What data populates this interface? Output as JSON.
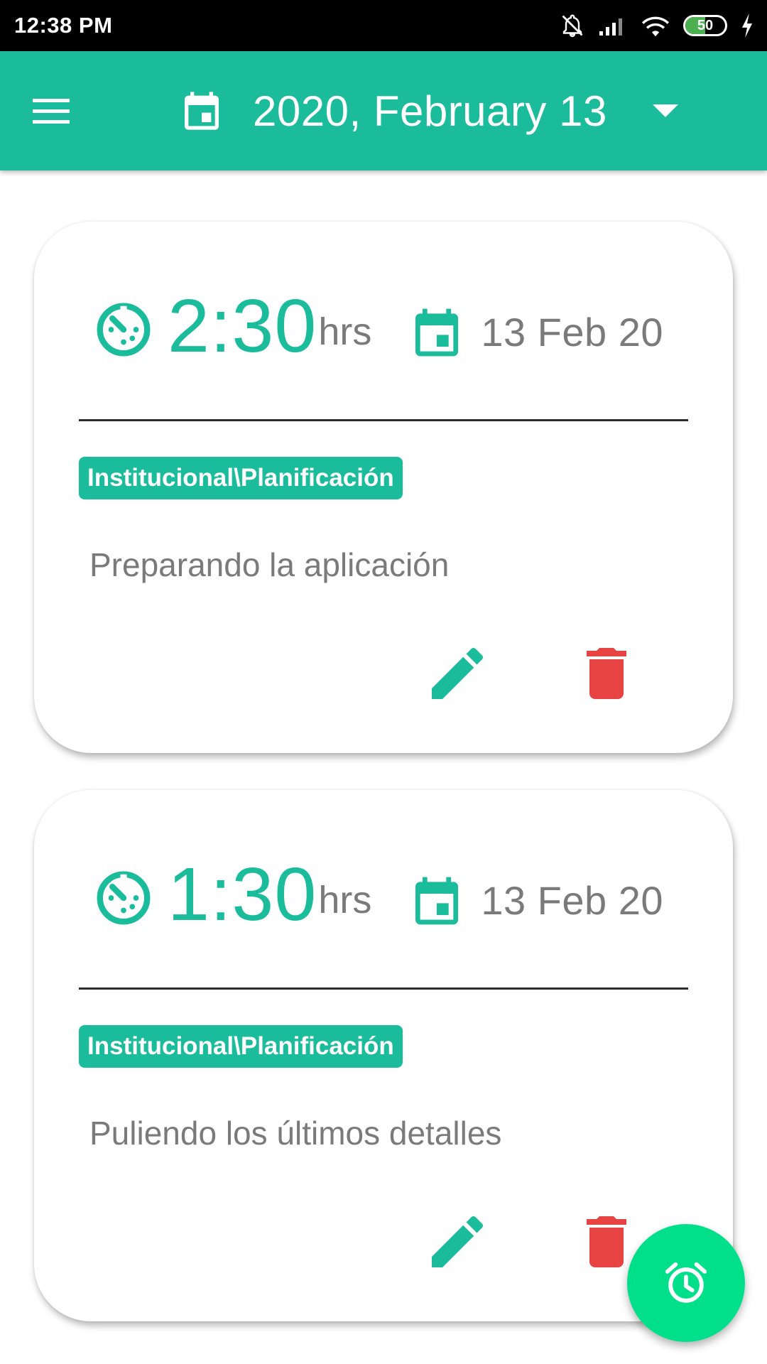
{
  "status_bar": {
    "time": "12:38 PM",
    "battery_level": "50",
    "icons": [
      "notifications-off-icon",
      "signal-icon",
      "wifi-icon",
      "battery-icon",
      "charging-icon"
    ]
  },
  "app_bar": {
    "menu_icon": "menu-icon",
    "calendar_icon": "calendar-icon",
    "date_title": "2020, February 13",
    "dropdown_icon": "dropdown-caret-icon",
    "background_color": "#1abc9c"
  },
  "entries": [
    {
      "duration": "2:30",
      "unit": "hrs",
      "date": "13 Feb 20",
      "category": "Institucional\\Planificación",
      "description": "Preparando la aplicación"
    },
    {
      "duration": "1:30",
      "unit": "hrs",
      "date": "13 Feb 20",
      "category": "Institucional\\Planificación",
      "description": "Puliendo los últimos detalles"
    }
  ],
  "colors": {
    "accent": "#1abc9c",
    "delete": "#e84343",
    "fab": "#00e08a",
    "secondary_text": "#7a7a7a"
  },
  "fab": {
    "icon": "alarm-clock-icon"
  }
}
